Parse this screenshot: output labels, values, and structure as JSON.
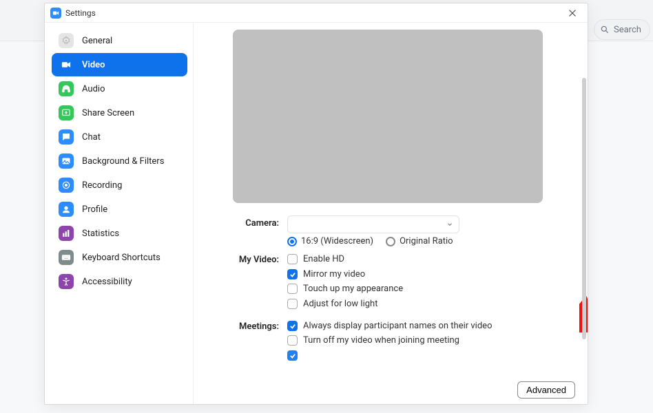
{
  "window": {
    "title": "Settings"
  },
  "search": {
    "placeholder": "Search"
  },
  "sidebar": {
    "items": [
      {
        "id": "general",
        "label": "General",
        "iconBg": "#E5E5E5",
        "active": false
      },
      {
        "id": "video",
        "label": "Video",
        "iconBg": "#0E72ED",
        "active": true
      },
      {
        "id": "audio",
        "label": "Audio",
        "iconBg": "#34C759",
        "active": false
      },
      {
        "id": "share",
        "label": "Share Screen",
        "iconBg": "#34C759",
        "active": false
      },
      {
        "id": "chat",
        "label": "Chat",
        "iconBg": "#2D8CFF",
        "active": false
      },
      {
        "id": "bgfilters",
        "label": "Background & Filters",
        "iconBg": "#2D8CFF",
        "active": false
      },
      {
        "id": "recording",
        "label": "Recording",
        "iconBg": "#2D8CFF",
        "active": false
      },
      {
        "id": "profile",
        "label": "Profile",
        "iconBg": "#2D8CFF",
        "active": false
      },
      {
        "id": "statistics",
        "label": "Statistics",
        "iconBg": "#8E44AD",
        "active": false
      },
      {
        "id": "keyboard",
        "label": "Keyboard Shortcuts",
        "iconBg": "#7F8C8D",
        "active": false
      },
      {
        "id": "a11y",
        "label": "Accessibility",
        "iconBg": "#8E44AD",
        "active": false
      }
    ]
  },
  "panel": {
    "camera_label": "Camera:",
    "camera_selected": "",
    "aspect": {
      "widescreen": "16:9 (Widescreen)",
      "original": "Original Ratio",
      "selected": "widescreen"
    },
    "myvideo_label": "My Video:",
    "myvideo_opts": {
      "enable_hd": {
        "label": "Enable HD",
        "checked": false
      },
      "mirror": {
        "label": "Mirror my video",
        "checked": true
      },
      "touchup": {
        "label": "Touch up my appearance",
        "checked": false
      },
      "lowlight": {
        "label": "Adjust for low light",
        "checked": false
      }
    },
    "meetings_label": "Meetings:",
    "meetings_opts": {
      "names": {
        "label": "Always display participant names on their video",
        "checked": true
      },
      "turnoff": {
        "label": "Turn off my video when joining meeting",
        "checked": false
      },
      "hidden3": {
        "label": "",
        "checked": true
      }
    },
    "advanced_btn": "Advanced"
  }
}
